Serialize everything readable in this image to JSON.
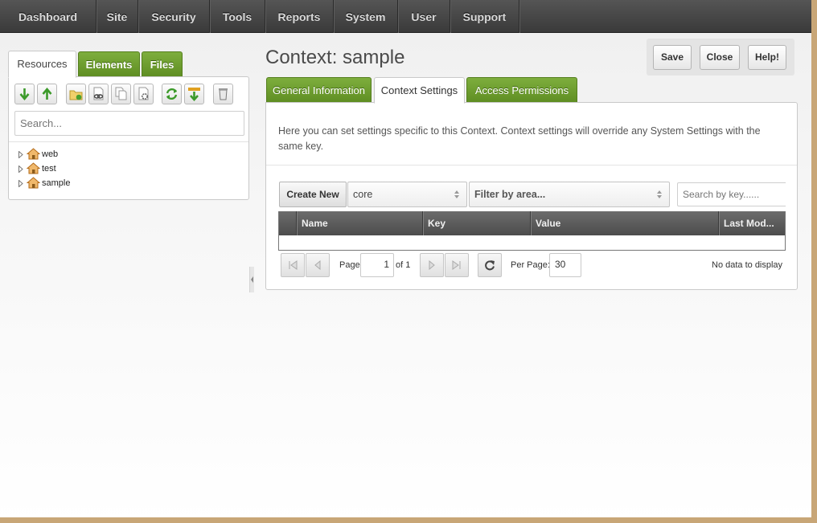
{
  "nav": {
    "items": [
      "Dashboard",
      "Site",
      "Security",
      "Tools",
      "Reports",
      "System",
      "User",
      "Support"
    ]
  },
  "left_panel": {
    "tabs": [
      "Resources",
      "Elements",
      "Files"
    ],
    "toolbar_icons": [
      "expand-all-icon",
      "collapse-all-icon",
      "new-document-icon",
      "new-weblink-icon",
      "new-symlink-icon",
      "new-static-resource-icon",
      "refresh-icon",
      "sort-icon",
      "purge-icon"
    ],
    "search_placeholder": "Search...",
    "tree": [
      "web",
      "test",
      "sample"
    ]
  },
  "main": {
    "title": "Context: sample",
    "actions": {
      "save": "Save",
      "close": "Close",
      "help": "Help!"
    },
    "tabs": [
      "General Information",
      "Context Settings",
      "Access Permissions"
    ],
    "active_tab": "Context Settings",
    "description": "Here you can set settings specific to this Context. Context settings will override any System Settings with the same key.",
    "create_button": "Create New",
    "namespace_value": "core",
    "area_placeholder": "Filter by area...",
    "key_search_placeholder": "Search by key......",
    "grid_columns": [
      "Name",
      "Key",
      "Value",
      "Last Mod..."
    ],
    "pager": {
      "page_label": "Page",
      "page_value": "1",
      "of_label": "of 1",
      "per_page_label": "Per Page:",
      "per_page_value": "30",
      "empty_message": "No data to display"
    }
  },
  "colors": {
    "nav_bg": "#3a3a3a",
    "tab_green": "#6a9a2e",
    "grid_header": "#555555",
    "frame_border": "#c8a677"
  }
}
